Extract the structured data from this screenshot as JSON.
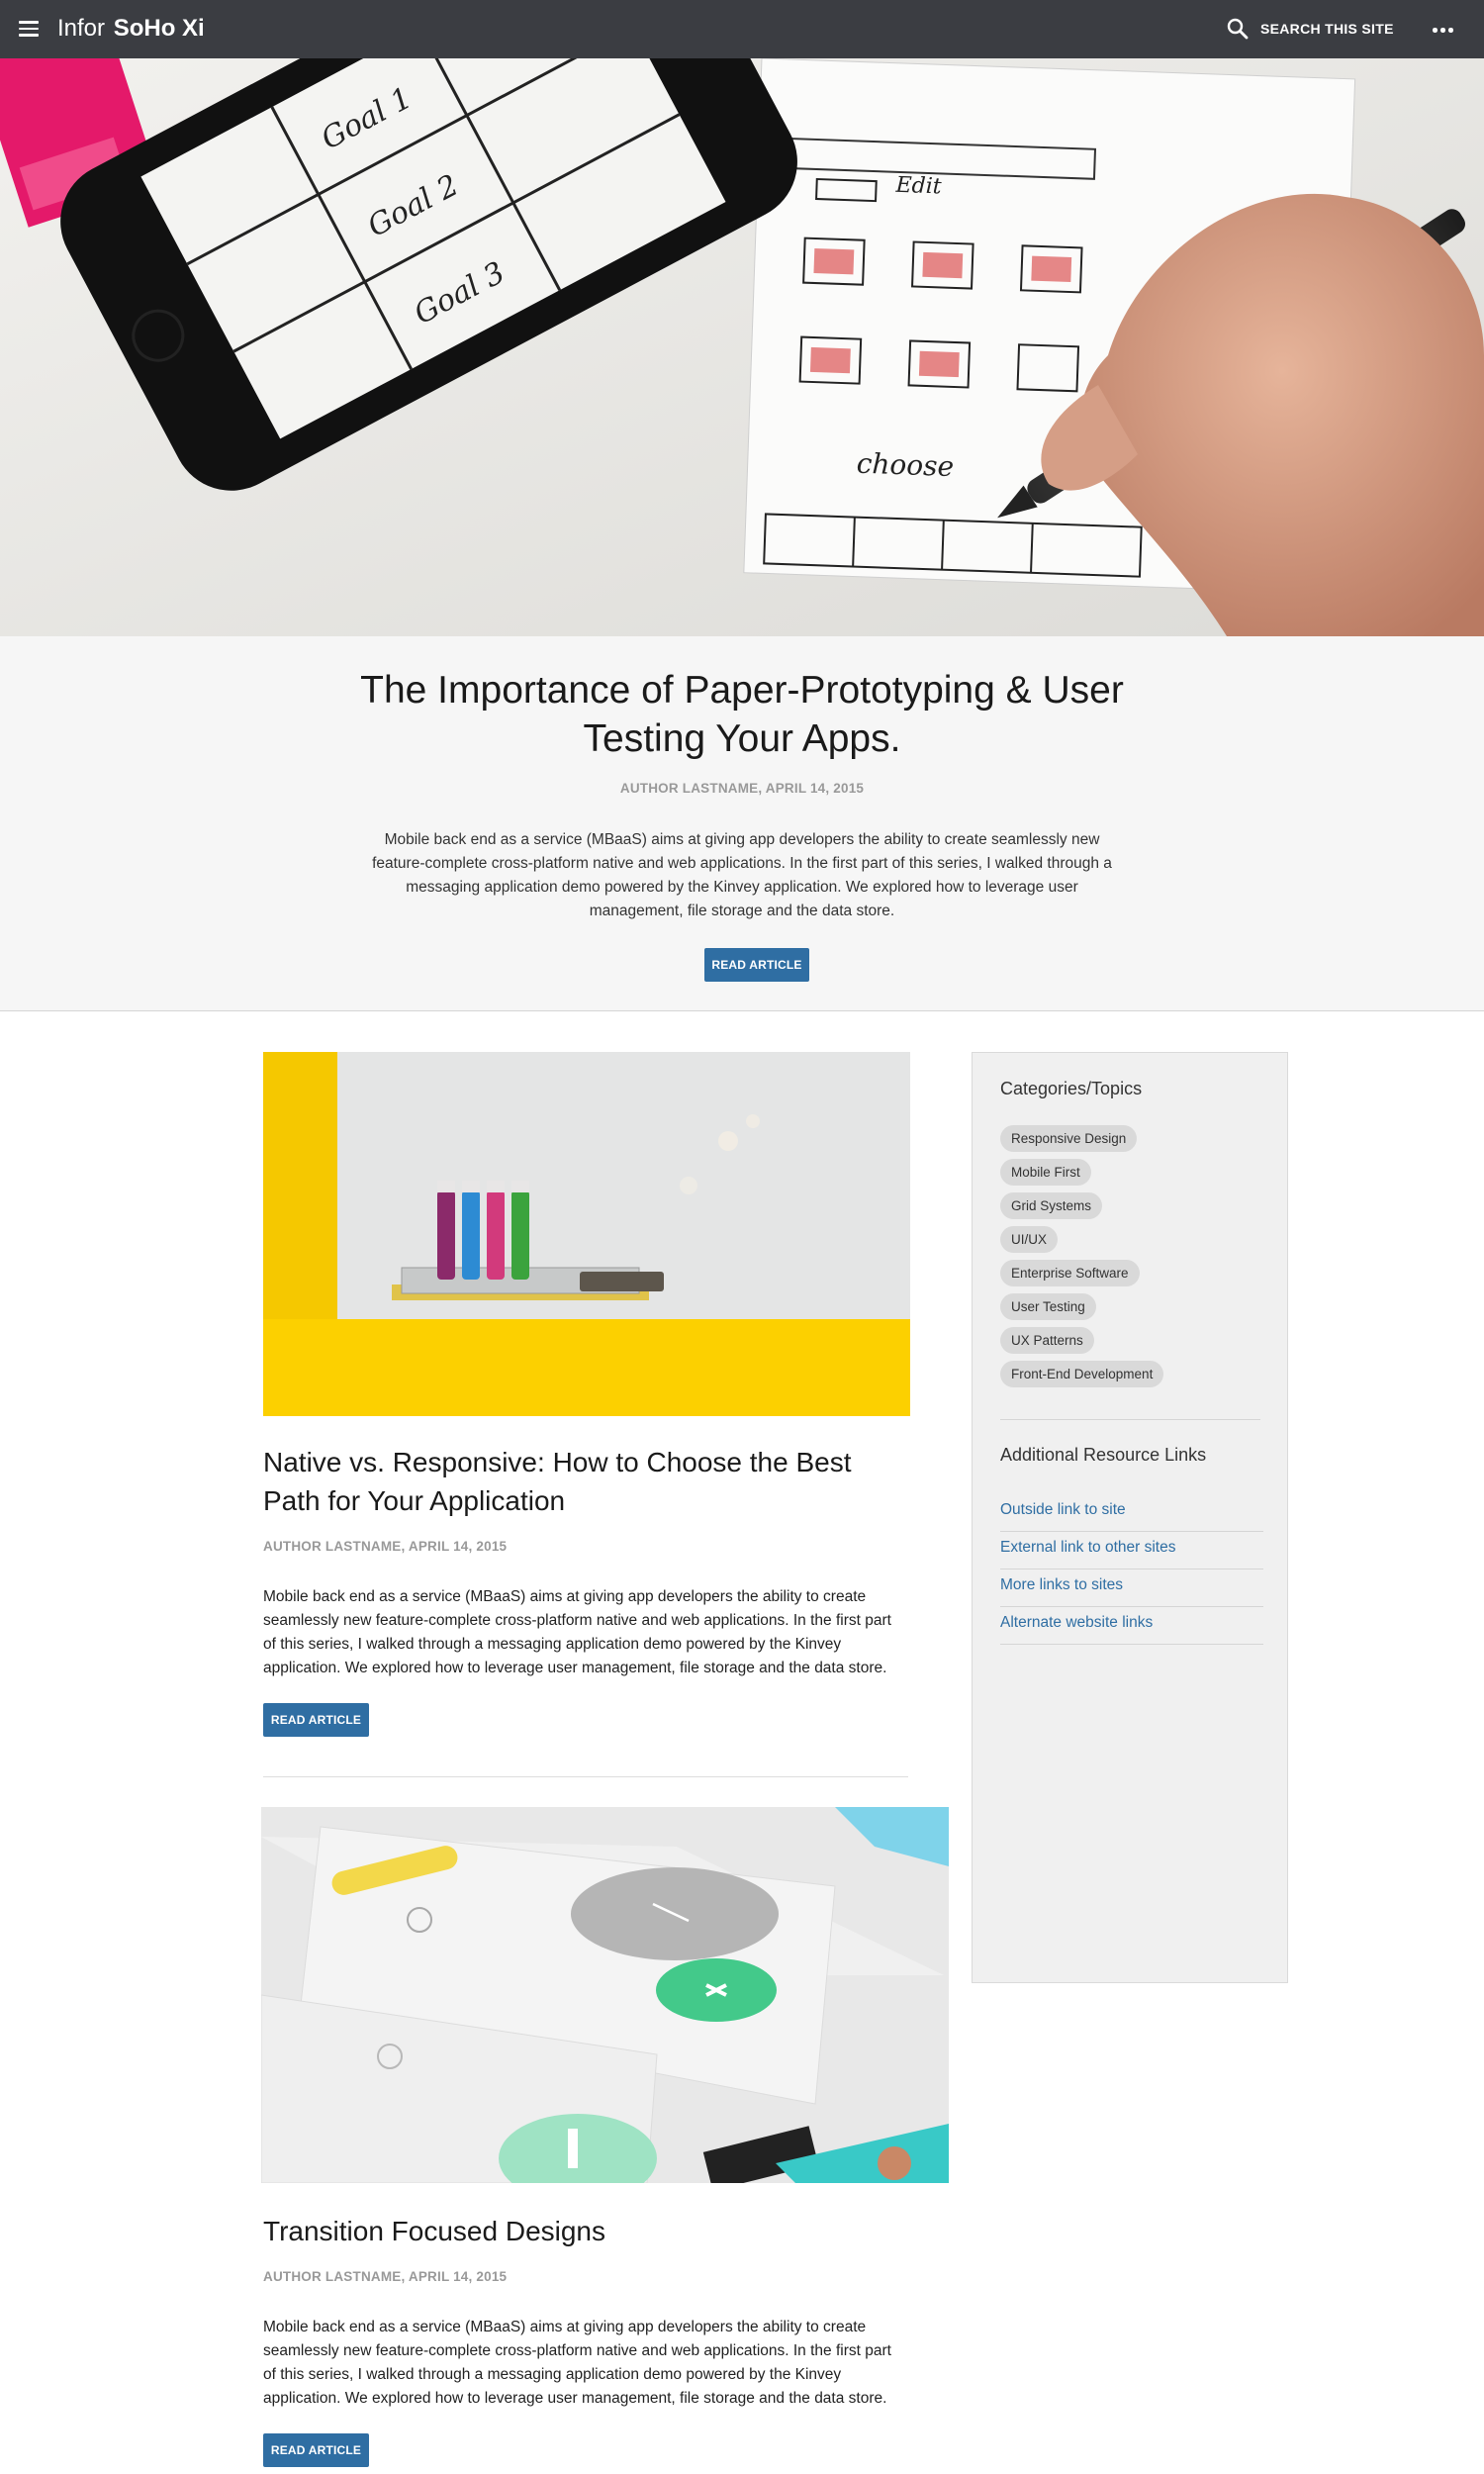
{
  "header": {
    "brand_light": "Infor",
    "brand_bold": "SoHo Xi",
    "search_label": "SEARCH THIS SITE",
    "icons": [
      "hamburger-menu-icon",
      "search-icon",
      "more-options-icon"
    ]
  },
  "hero": {
    "image": "paper-prototype-sketch-photo",
    "title": "The Importance of Paper-Prototyping & User Testing Your Apps.",
    "meta": "AUTHOR LASTNAME, APRIL 14, 2015",
    "description": "Mobile back end as a service (MBaaS) aims at giving app developers the ability to create seamlessly new feature-complete cross-platform native and web applications. In the first part of this series, I walked through a messaging application demo powered by the Kinvey application. We explored how to leverage user management, file storage and the data store.",
    "button": "READ ARTICLE"
  },
  "articles": [
    {
      "image": "whiteboard-markers-photo",
      "title": "Native vs. Responsive: How to Choose the Best Path for Your Application",
      "meta": "AUTHOR LASTNAME, APRIL 14, 2015",
      "description": "Mobile back end as a service (MBaaS) aims at giving app developers the ability to create seamlessly new feature-complete cross-platform native and web applications. In the first part of this series, I walked through a messaging application demo powered by the Kinvey application. We explored how to leverage user management, file storage and the data store.",
      "button": "READ ARTICLE"
    },
    {
      "image": "transition-ui-mockup-illustration",
      "title": "Transition Focused Designs",
      "meta": "AUTHOR LASTNAME, APRIL 14, 2015",
      "description": "Mobile back end as a service (MBaaS) aims at giving app developers the ability to create seamlessly new feature-complete cross-platform native and web applications. In the first part of this series, I walked through a messaging application demo powered by the Kinvey application. We explored how to leverage user management, file storage and the data store.",
      "button": "READ ARTICLE"
    }
  ],
  "sidebar": {
    "categories_title": "Categories/Topics",
    "categories": [
      "Responsive Design",
      "Mobile First",
      "Grid Systems",
      "UI/UX",
      "Enterprise Software",
      "User Testing",
      "UX Patterns",
      "Front-End Development"
    ],
    "links_title": "Additional Resource Links",
    "links": [
      "Outside link to site",
      "External link to other sites",
      "More links to sites",
      "Alternate website links"
    ]
  },
  "colors": {
    "header_bg": "#3b3d42",
    "accent_button": "#2f6ea3",
    "link": "#2f6ea3",
    "sidebar_bg": "#f0f0f0",
    "hero_info_bg": "#f6f6f6"
  }
}
